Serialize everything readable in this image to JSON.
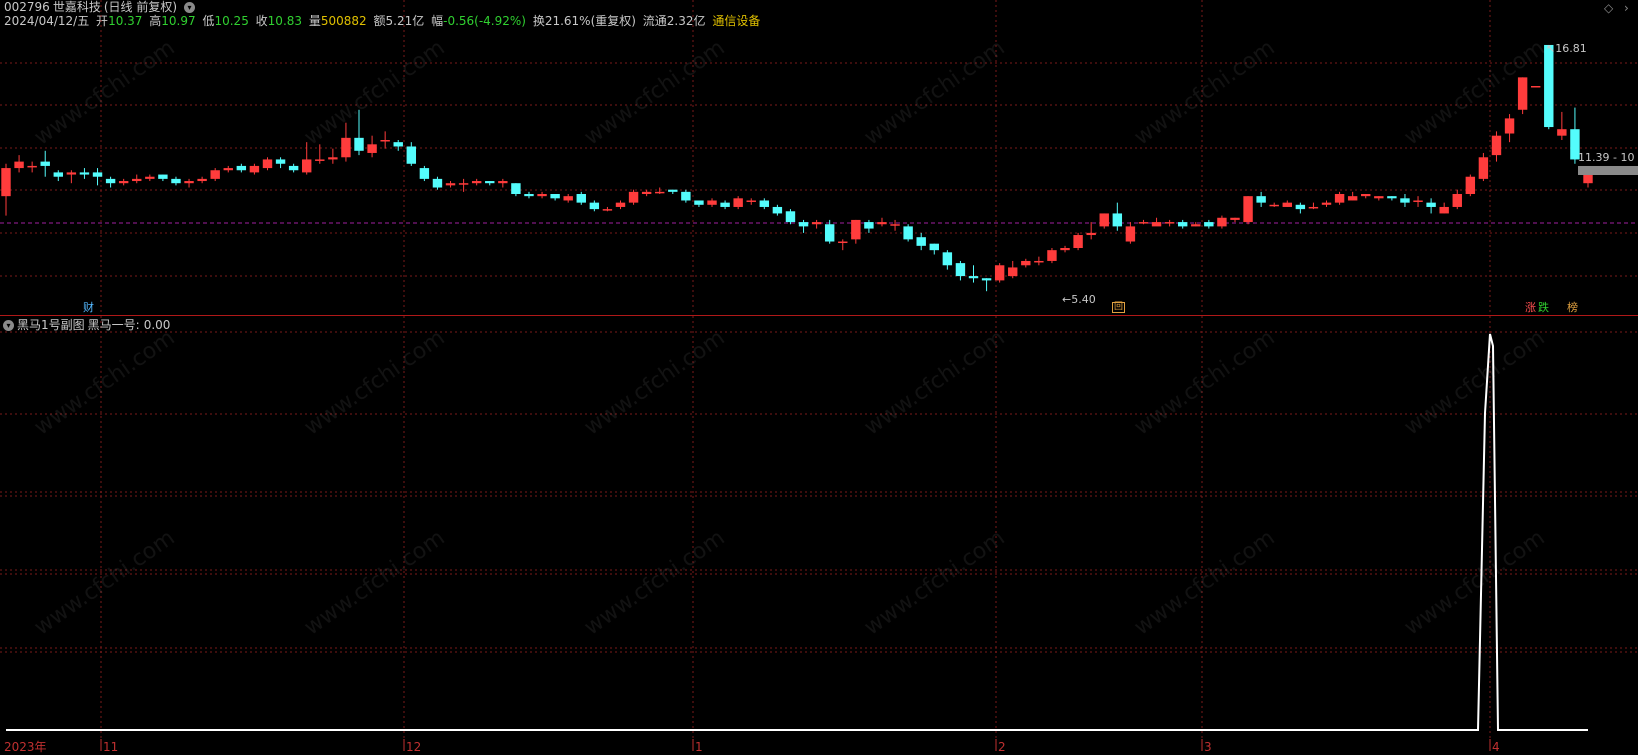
{
  "header": {
    "code": "002796",
    "name": "世嘉科技",
    "mode": "(日线 前复权)",
    "date": "2024/04/12/五",
    "open_label": "开",
    "open": "10.37",
    "high_label": "高",
    "high": "10.97",
    "low_label": "低",
    "low": "10.25",
    "close_label": "收",
    "close": "10.83",
    "vol_label": "量",
    "vol": "500882",
    "amount_label": "额",
    "amount": "5.21亿",
    "change_label": "幅",
    "change": "-0.56(-4.92%)",
    "turnover_label": "换",
    "turnover": "21.61%(重复权)",
    "float_label": "流通",
    "float": "2.32亿",
    "industry": "通信设备"
  },
  "main_chart": {
    "max_label": "16.81",
    "min_label": "5.40",
    "price_tag": "11.39 - 10",
    "badge_cai": "财",
    "badge_hui": "回",
    "badge_zhang": "涨",
    "badge_die": "跌",
    "badge_bang": "榜"
  },
  "sub_chart": {
    "title": "黑马1号副图",
    "series_label": "黑马一号:",
    "series_value": "0.00"
  },
  "watermark": "www.cfchi.com",
  "axis": {
    "labels": [
      "2023年",
      "11",
      "12",
      "1",
      "2",
      "3",
      "4"
    ]
  },
  "colors": {
    "up": "#ff3c3c",
    "down": "#54fcfc",
    "grid": "#7a1a1a",
    "purple_line": "#a020a0",
    "indicator": "#ffffff"
  },
  "chart_data": [
    {
      "type": "candlestick",
      "title": "",
      "ylim": [
        4.9,
        17.4
      ],
      "candles": [
        [
          9.8,
          11.1,
          8.9,
          11.3
        ],
        [
          11.1,
          11.4,
          10.9,
          11.7
        ],
        [
          11.2,
          11.2,
          10.9,
          11.4
        ],
        [
          11.4,
          11.2,
          10.7,
          11.9
        ],
        [
          10.9,
          10.7,
          10.5,
          11.0
        ],
        [
          10.8,
          10.9,
          10.4,
          11.0
        ],
        [
          10.9,
          10.8,
          10.6,
          11.1
        ],
        [
          10.9,
          10.7,
          10.3,
          11.1
        ],
        [
          10.6,
          10.4,
          10.2,
          10.7
        ],
        [
          10.4,
          10.5,
          10.3,
          10.6
        ],
        [
          10.5,
          10.6,
          10.4,
          10.8
        ],
        [
          10.6,
          10.7,
          10.5,
          10.8
        ],
        [
          10.8,
          10.6,
          10.5,
          10.8
        ],
        [
          10.6,
          10.4,
          10.3,
          10.7
        ],
        [
          10.4,
          10.5,
          10.2,
          10.6
        ],
        [
          10.5,
          10.6,
          10.4,
          10.7
        ],
        [
          10.6,
          11.0,
          10.5,
          11.1
        ],
        [
          11.0,
          11.1,
          10.9,
          11.2
        ],
        [
          11.2,
          11.0,
          10.9,
          11.3
        ],
        [
          10.9,
          11.2,
          10.8,
          11.3
        ],
        [
          11.1,
          11.5,
          11.0,
          11.6
        ],
        [
          11.5,
          11.3,
          11.1,
          11.6
        ],
        [
          11.2,
          11.0,
          10.9,
          11.3
        ],
        [
          10.9,
          11.5,
          10.8,
          12.3
        ],
        [
          11.5,
          11.5,
          11.3,
          12.2
        ],
        [
          11.5,
          11.6,
          11.3,
          12.0
        ],
        [
          11.6,
          12.5,
          11.4,
          13.2
        ],
        [
          12.5,
          11.9,
          11.7,
          13.8
        ],
        [
          11.8,
          12.2,
          11.6,
          12.6
        ],
        [
          12.4,
          12.4,
          12.0,
          12.8
        ],
        [
          12.3,
          12.1,
          11.9,
          12.4
        ],
        [
          12.1,
          11.3,
          11.2,
          12.3
        ],
        [
          11.1,
          10.6,
          10.5,
          11.2
        ],
        [
          10.6,
          10.2,
          10.1,
          10.7
        ],
        [
          10.3,
          10.4,
          10.2,
          10.5
        ],
        [
          10.4,
          10.4,
          10.0,
          10.6
        ],
        [
          10.4,
          10.5,
          10.3,
          10.6
        ],
        [
          10.5,
          10.4,
          10.3,
          10.5
        ],
        [
          10.4,
          10.5,
          10.2,
          10.6
        ],
        [
          10.4,
          9.9,
          9.8,
          10.4
        ],
        [
          9.9,
          9.8,
          9.7,
          10.0
        ],
        [
          9.8,
          9.9,
          9.7,
          10.0
        ],
        [
          9.9,
          9.7,
          9.6,
          9.9
        ],
        [
          9.6,
          9.8,
          9.5,
          9.9
        ],
        [
          9.9,
          9.5,
          9.4,
          10.0
        ],
        [
          9.5,
          9.2,
          9.1,
          9.6
        ],
        [
          9.2,
          9.2,
          9.1,
          9.3
        ],
        [
          9.3,
          9.5,
          9.2,
          9.6
        ],
        [
          9.5,
          10.0,
          9.4,
          10.1
        ],
        [
          9.9,
          10.0,
          9.8,
          10.1
        ],
        [
          10.0,
          10.0,
          9.9,
          10.2
        ],
        [
          10.1,
          10.0,
          9.9,
          10.1
        ],
        [
          10.0,
          9.6,
          9.5,
          10.1
        ],
        [
          9.6,
          9.4,
          9.3,
          9.6
        ],
        [
          9.4,
          9.6,
          9.3,
          9.7
        ],
        [
          9.5,
          9.3,
          9.2,
          9.6
        ],
        [
          9.3,
          9.7,
          9.2,
          9.8
        ],
        [
          9.6,
          9.6,
          9.4,
          9.7
        ],
        [
          9.6,
          9.3,
          9.2,
          9.7
        ],
        [
          9.3,
          9.0,
          8.9,
          9.4
        ],
        [
          9.1,
          8.6,
          8.5,
          9.2
        ],
        [
          8.6,
          8.4,
          8.1,
          8.7
        ],
        [
          8.5,
          8.6,
          8.3,
          8.7
        ],
        [
          8.5,
          7.7,
          7.6,
          8.7
        ],
        [
          7.7,
          7.7,
          7.3,
          7.8
        ],
        [
          7.8,
          8.7,
          7.6,
          8.7
        ],
        [
          8.6,
          8.3,
          8.1,
          8.7
        ],
        [
          8.5,
          8.6,
          8.4,
          8.8
        ],
        [
          8.5,
          8.5,
          8.2,
          8.7
        ],
        [
          8.4,
          7.8,
          7.7,
          8.5
        ],
        [
          7.9,
          7.5,
          7.3,
          8.1
        ],
        [
          7.6,
          7.3,
          7.1,
          7.6
        ],
        [
          7.2,
          6.6,
          6.4,
          7.3
        ],
        [
          6.7,
          6.1,
          5.9,
          6.8
        ],
        [
          6.1,
          6.0,
          5.8,
          6.6
        ],
        [
          6.0,
          5.9,
          5.4,
          6.0
        ],
        [
          5.9,
          6.6,
          5.8,
          6.7
        ],
        [
          6.1,
          6.5,
          6.0,
          6.8
        ],
        [
          6.6,
          6.8,
          6.5,
          6.9
        ],
        [
          6.8,
          6.8,
          6.6,
          7.0
        ],
        [
          6.8,
          7.3,
          6.7,
          7.4
        ],
        [
          7.3,
          7.4,
          7.2,
          7.5
        ],
        [
          7.4,
          8.0,
          7.3,
          8.1
        ],
        [
          8.0,
          8.1,
          7.8,
          8.6
        ],
        [
          8.4,
          9.0,
          8.3,
          9.0
        ],
        [
          9.0,
          8.4,
          8.2,
          9.5
        ],
        [
          7.7,
          8.4,
          7.6,
          8.6
        ],
        [
          8.6,
          8.6,
          8.5,
          8.7
        ],
        [
          8.4,
          8.6,
          8.5,
          8.8
        ],
        [
          8.6,
          8.6,
          8.4,
          8.7
        ],
        [
          8.6,
          8.4,
          8.3,
          8.7
        ],
        [
          8.4,
          8.5,
          8.4,
          8.6
        ],
        [
          8.6,
          8.4,
          8.3,
          8.7
        ],
        [
          8.4,
          8.8,
          8.3,
          8.9
        ],
        [
          8.7,
          8.8,
          8.6,
          8.8
        ],
        [
          8.6,
          9.8,
          8.5,
          9.8
        ],
        [
          9.8,
          9.5,
          9.3,
          10.0
        ],
        [
          9.4,
          9.4,
          9.3,
          9.5
        ],
        [
          9.3,
          9.5,
          9.3,
          9.6
        ],
        [
          9.4,
          9.2,
          9.0,
          9.5
        ],
        [
          9.3,
          9.3,
          9.2,
          9.5
        ],
        [
          9.4,
          9.5,
          9.3,
          9.6
        ],
        [
          9.5,
          9.9,
          9.4,
          10.0
        ],
        [
          9.6,
          9.8,
          9.6,
          10.0
        ],
        [
          9.8,
          9.9,
          9.7,
          9.9
        ],
        [
          9.7,
          9.8,
          9.6,
          9.8
        ],
        [
          9.8,
          9.7,
          9.6,
          9.8
        ],
        [
          9.7,
          9.5,
          9.3,
          9.9
        ],
        [
          9.6,
          9.6,
          9.3,
          9.8
        ],
        [
          9.5,
          9.3,
          9.0,
          9.7
        ],
        [
          9.0,
          9.3,
          9.0,
          9.5
        ],
        [
          9.3,
          9.9,
          9.2,
          10.1
        ],
        [
          9.9,
          10.7,
          9.8,
          10.8
        ],
        [
          10.6,
          11.6,
          10.5,
          11.8
        ],
        [
          11.7,
          12.6,
          11.4,
          12.8
        ],
        [
          12.7,
          13.4,
          12.3,
          13.6
        ],
        [
          13.8,
          15.3,
          13.6,
          15.3
        ],
        [
          14.9,
          14.9,
          14.9,
          14.9
        ],
        [
          16.8,
          13.0,
          12.9,
          16.8
        ],
        [
          12.6,
          12.9,
          12.4,
          13.7
        ],
        [
          12.9,
          11.5,
          11.3,
          13.9
        ],
        [
          10.4,
          10.8,
          10.2,
          11.0
        ]
      ]
    },
    {
      "type": "line",
      "title": "黑马1号副图",
      "series": [
        {
          "name": "黑马一号",
          "values": "0 on every day except day 3 of the last month (April): peak ≈1.0, daily values [0, 0, 0.95, 1.0, 0.9, 0, 0]",
          "ylim": [
            0,
            1.1
          ]
        }
      ]
    }
  ]
}
